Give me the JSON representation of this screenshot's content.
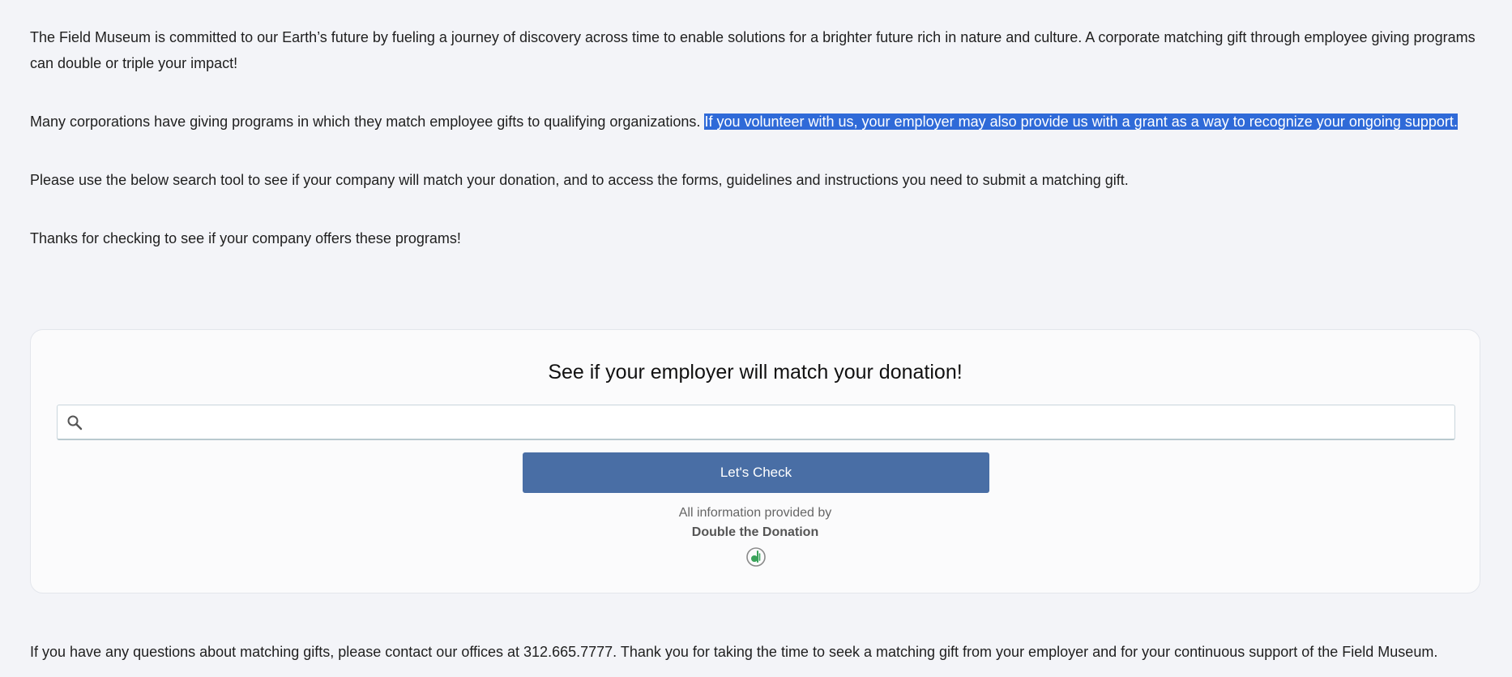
{
  "intro": {
    "p1": "The Field Museum is committed to our Earth’s future by fueling a journey of discovery across time to enable solutions for a brighter future rich in nature and culture. A corporate matching gift through employee giving programs can double or triple your impact!",
    "p2_normal": "Many corporations have giving programs in which they match employee gifts to qualifying organizations. ",
    "p2_selected": "If you volunteer with us, your employer may also provide us with a grant as a way to recognize your ongoing support.",
    "p3": "Please use the below search tool to see if your company will match your donation, and to access the forms, guidelines and instructions you need to submit a matching gift.",
    "p4": "Thanks for checking to see if your company offers these programs!"
  },
  "widget": {
    "title": "See if your employer will match your donation!",
    "search": {
      "value": "",
      "placeholder": "",
      "icon": "search-icon"
    },
    "button_label": "Let's Check",
    "credit_line": "All information provided by",
    "credit_brand": "Double the Donation",
    "logo_icon": "double-the-donation-logo-icon"
  },
  "footer": {
    "text": "If you have any questions about matching gifts, please contact our offices at 312.665.7777. Thank you for taking the time to seek a matching gift from your employer and for your continuous support of the Field Museum."
  },
  "colors": {
    "background": "#f3f4f8",
    "selection": "#2f6ad8",
    "button": "#496ea5",
    "logo_green": "#3aa35a"
  }
}
